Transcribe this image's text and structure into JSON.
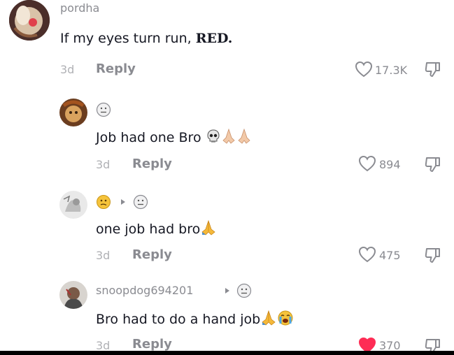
{
  "comments": [
    {
      "username": "pordha",
      "text_prefix": "If my eyes turn run, ",
      "text_bold": "RED.",
      "time": "3d",
      "reply_label": "Reply",
      "likes": "17.3K",
      "liked": false
    },
    {
      "username": "",
      "text": "Job had one Bro",
      "time": "3d",
      "reply_label": "Reply",
      "likes": "894",
      "liked": false
    },
    {
      "username": "",
      "text": "one job had bro",
      "time": "3d",
      "reply_label": "Reply",
      "likes": "475",
      "liked": false
    },
    {
      "username": "snoopdog694201",
      "text": "Bro had to do a hand job",
      "time": "3d",
      "reply_label": "Reply",
      "likes": "370",
      "liked": true
    }
  ],
  "icons": {
    "like": "heart-icon",
    "dislike": "thumbs-down-icon",
    "reply_arrow": "play-arrow-icon"
  },
  "colors": {
    "liked_heart": "#fe2c55",
    "muted_text": "#8a8b91"
  }
}
